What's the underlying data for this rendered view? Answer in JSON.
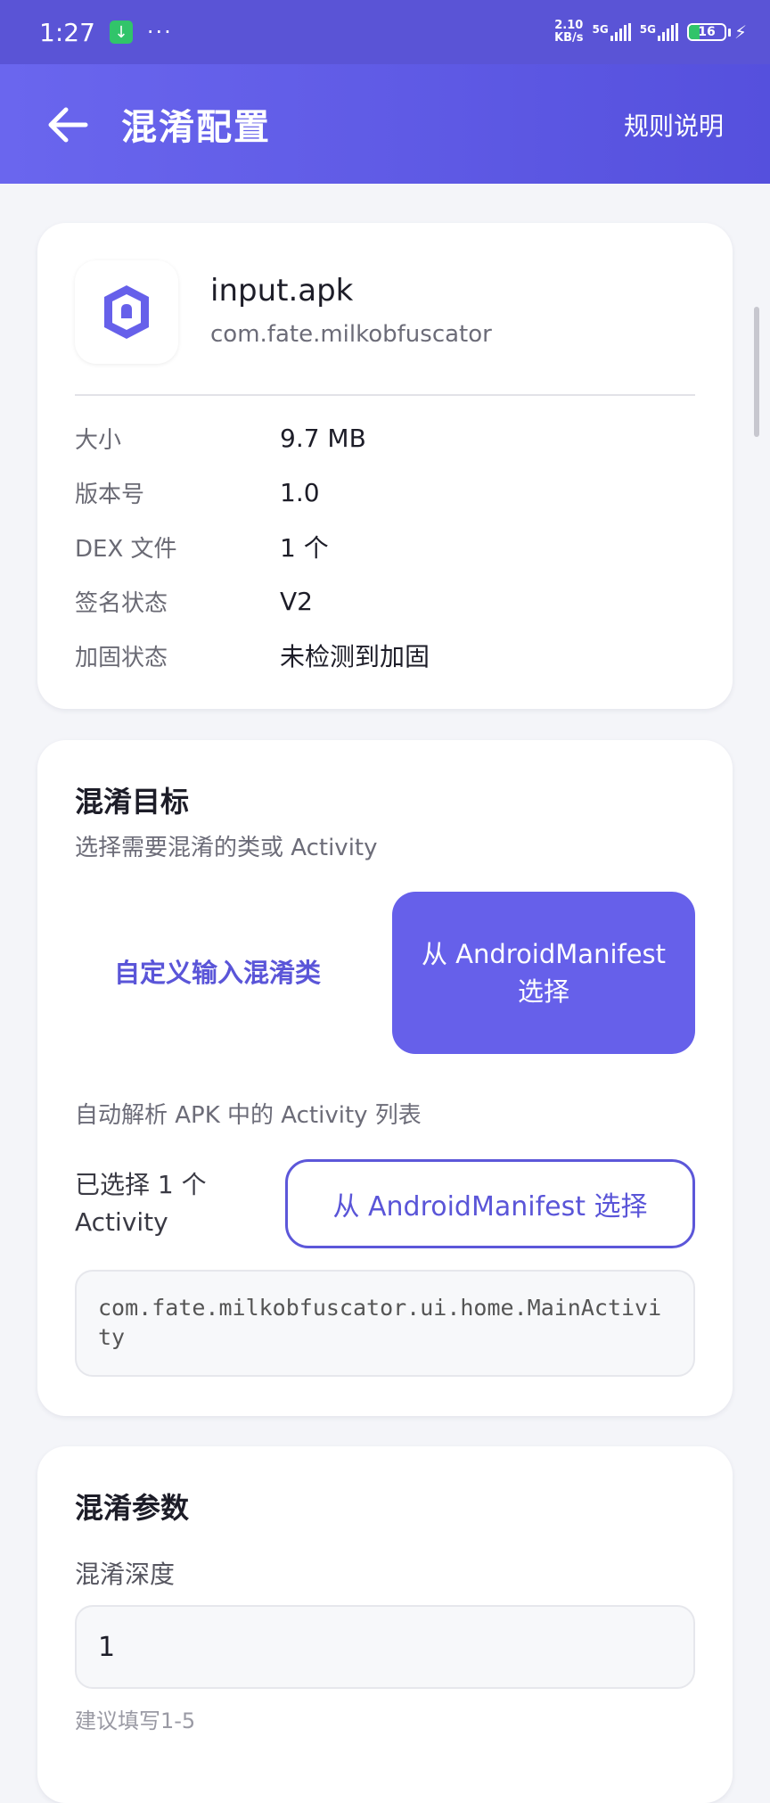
{
  "status_bar": {
    "time": "1:27",
    "download_icon": "download-icon",
    "dots": "···",
    "net_speed_value": "2.10",
    "net_speed_unit": "KB/s",
    "sim1_label": "5G",
    "sim2_label": "5G",
    "battery_level": "16"
  },
  "header": {
    "title": "混淆配置",
    "help_label": "规则说明"
  },
  "app_info": {
    "icon": "shield-icon",
    "apk_name": "input.apk",
    "package_name": "com.fate.milkobfuscator",
    "rows": [
      {
        "label": "大小",
        "value": "9.7 MB"
      },
      {
        "label": "版本号",
        "value": "1.0"
      },
      {
        "label": "DEX 文件",
        "value": "1 个"
      },
      {
        "label": "签名状态",
        "value": "V2"
      },
      {
        "label": "加固状态",
        "value": "未检测到加固"
      }
    ]
  },
  "target": {
    "title": "混淆目标",
    "subtitle": "选择需要混淆的类或 Activity",
    "option_custom": "自定义输入混淆类",
    "option_manifest": "从 AndroidManifest 选择",
    "hint": "自动解析 APK 中的 Activity 列表",
    "selected_count": "已选择 1 个 Activity",
    "select_button": "从 AndroidManifest 选择",
    "selected_activity": "com.fate.milkobfuscator.ui.home.MainActivity"
  },
  "params": {
    "title": "混淆参数",
    "depth_label": "混淆深度",
    "depth_value": "1",
    "depth_helper": "建议填写1-5"
  }
}
